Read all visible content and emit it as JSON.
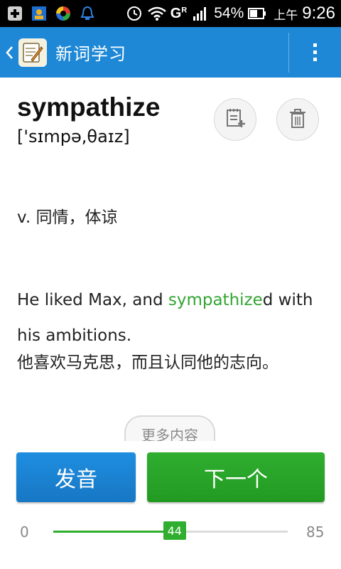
{
  "status_bar": {
    "icons": [
      "add-square-icon",
      "contacts-icon",
      "app-swirl-icon",
      "alarm-ring-icon",
      "clock-icon",
      "wifi-icon",
      "signal-icon"
    ],
    "network_label": "G",
    "network_sub": "R",
    "battery_percent": "54%",
    "ampm": "上午",
    "time": "9:26"
  },
  "action_bar": {
    "title": "新词学习"
  },
  "word_card": {
    "word": "sympathize",
    "phonetic": "['sɪmpə,θaɪz]",
    "meaning": "v. 同情，体谅",
    "example_en_pre": "He liked Max, and ",
    "example_en_highlight": "sympathize",
    "example_en_post": "d with his ambitions.",
    "example_cn": "他喜欢马克思，而且认同他的志向。",
    "more_label": "更多内容"
  },
  "actions": {
    "pronounce_label": "发音",
    "next_label": "下一个"
  },
  "progress": {
    "min": "0",
    "max": "85",
    "current": "44",
    "current_value": 44,
    "max_value": 85
  },
  "colors": {
    "action_bar": "#1e88d6",
    "accent_green": "#2fae2f",
    "highlight_green": "#33a532"
  }
}
